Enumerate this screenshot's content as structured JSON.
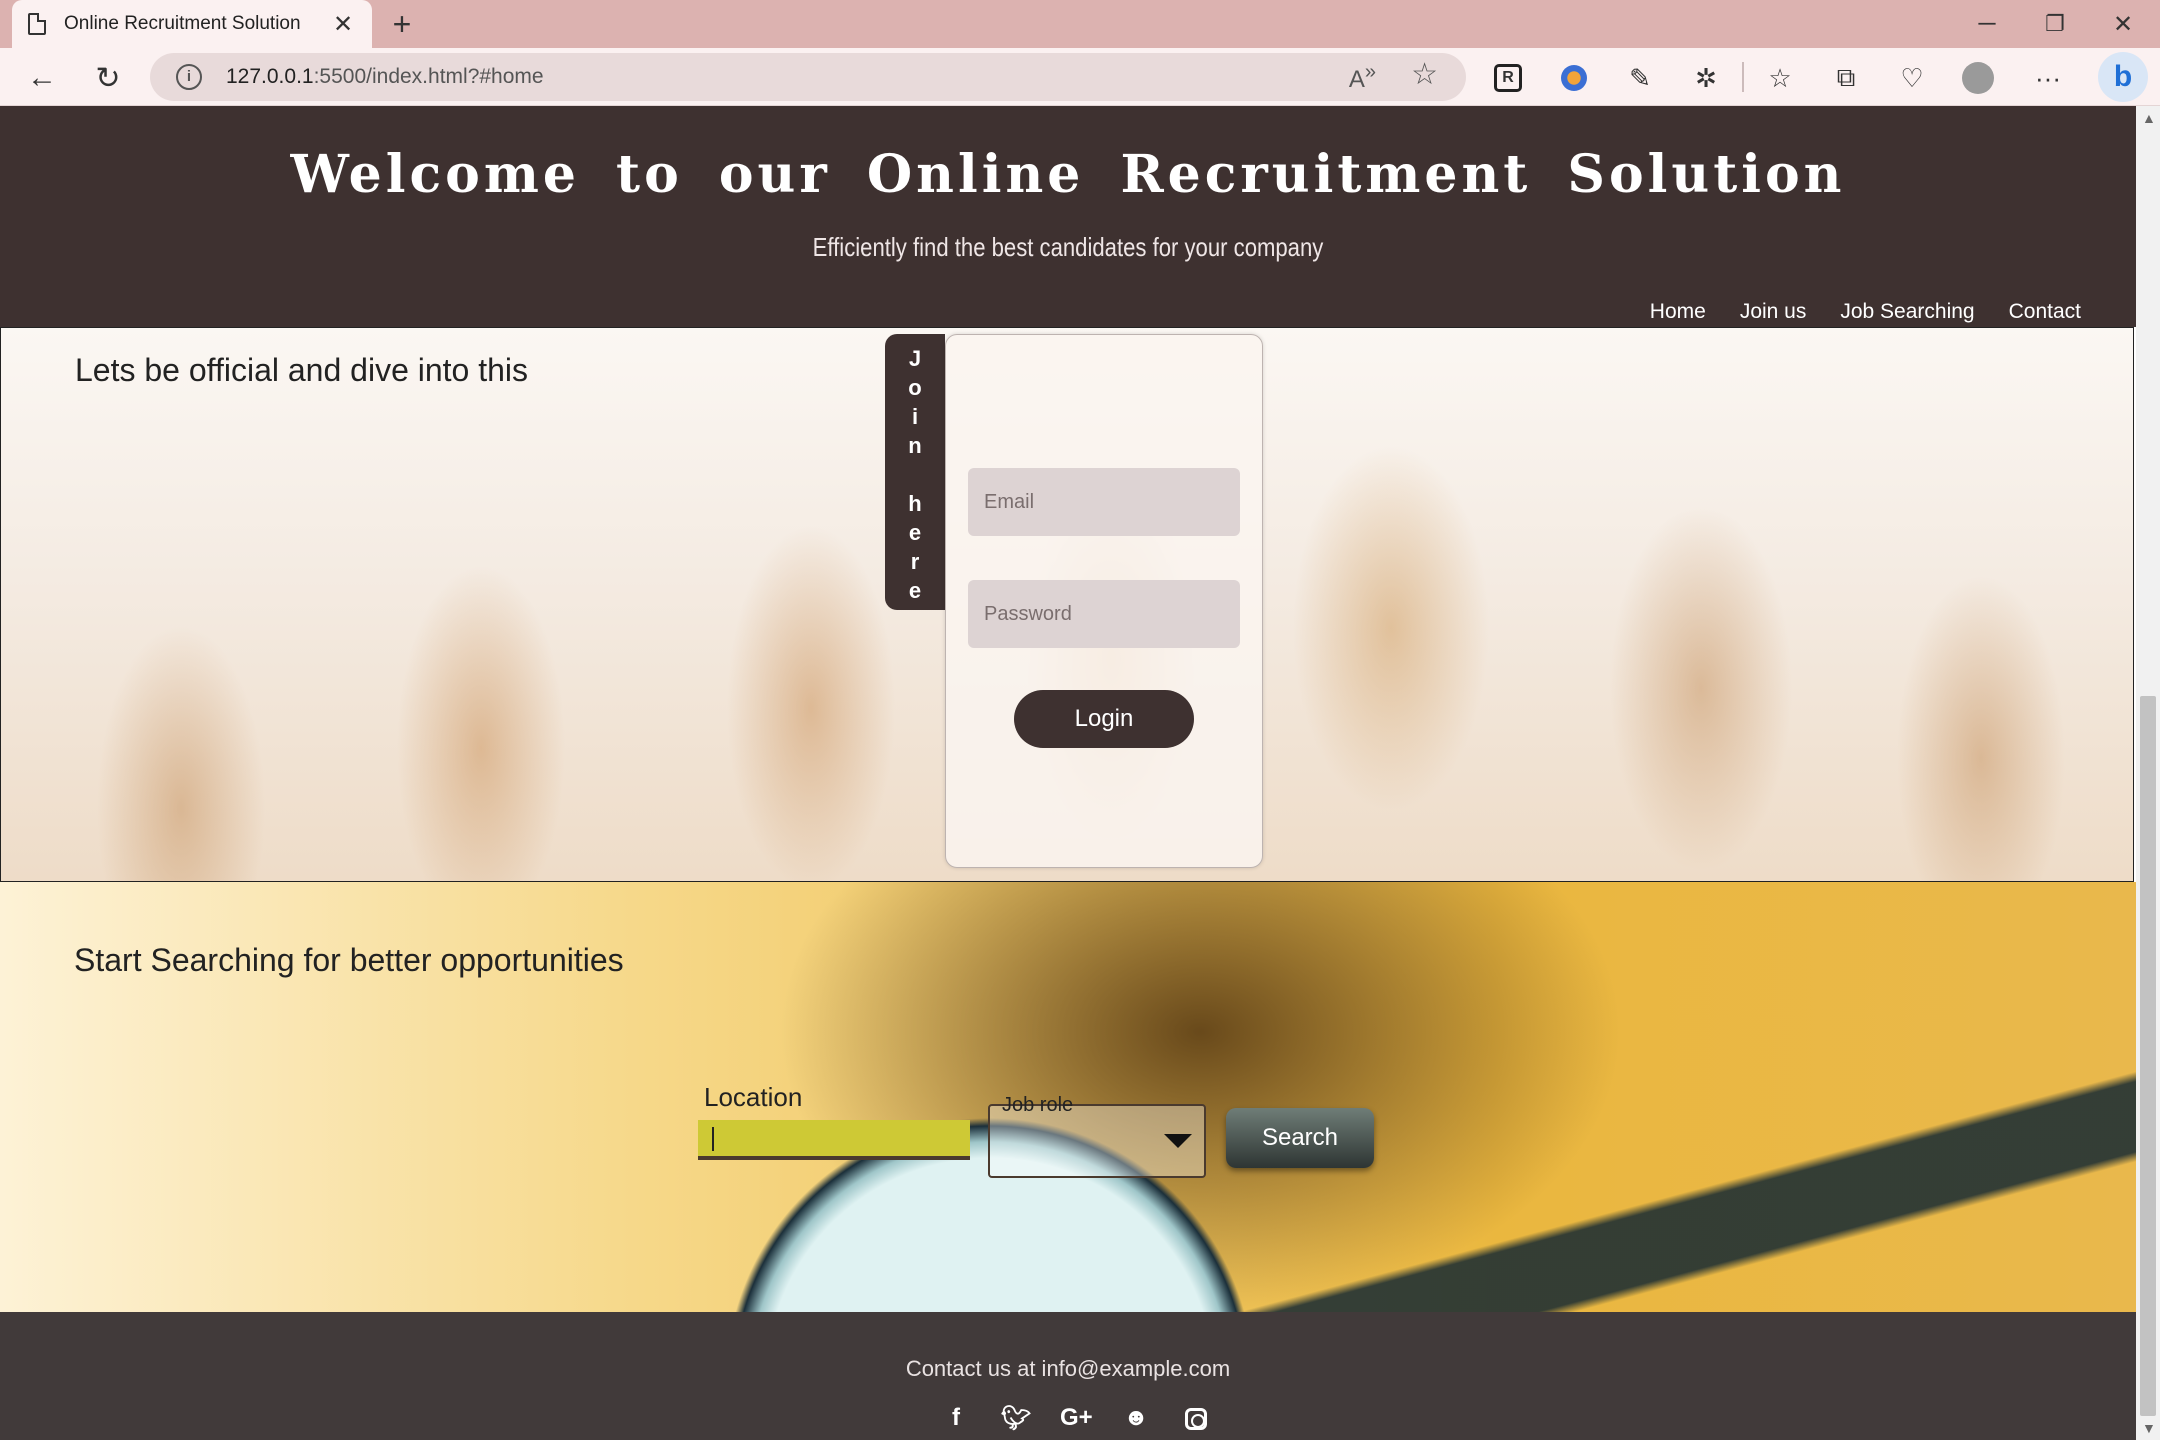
{
  "browser": {
    "tab_title": "Online Recruitment Solution",
    "tab_close": "✕",
    "new_tab": "+",
    "url_host": "127.0.0.1",
    "url_rest": ":5500/index.html?#home",
    "window_minimize": "─",
    "window_restore": "❐",
    "window_close": "✕"
  },
  "header": {
    "title": "Welcome to our Online Recruitment Solution",
    "subtitle": "Efficiently find the best candidates for your company",
    "nav": [
      "Home",
      "Join us",
      "Job Searching",
      "Contact"
    ]
  },
  "hero": {
    "heading": "Lets be official and dive into this",
    "join_tab_letters": [
      "J",
      "o",
      "i",
      "n",
      "",
      "h",
      "e",
      "r",
      "e"
    ],
    "email_placeholder": "Email",
    "password_placeholder": "Password",
    "login_label": "Login"
  },
  "search": {
    "heading": "Start Searching for better opportunities",
    "location_label": "Location",
    "location_value": "",
    "jobrole_label": "Job role",
    "jobrole_value": "",
    "search_label": "Search"
  },
  "footer": {
    "contact_text": "Contact us at info@example.com",
    "socials": [
      "facebook-icon",
      "twitter-icon",
      "google-plus-icon",
      "reddit-icon",
      "instagram-icon"
    ]
  },
  "colors": {
    "header_bg": "#3e3130",
    "footer_bg": "#413a3a",
    "location_input_bg": "#cec935",
    "tabbar_bg": "#dcb2b0"
  }
}
